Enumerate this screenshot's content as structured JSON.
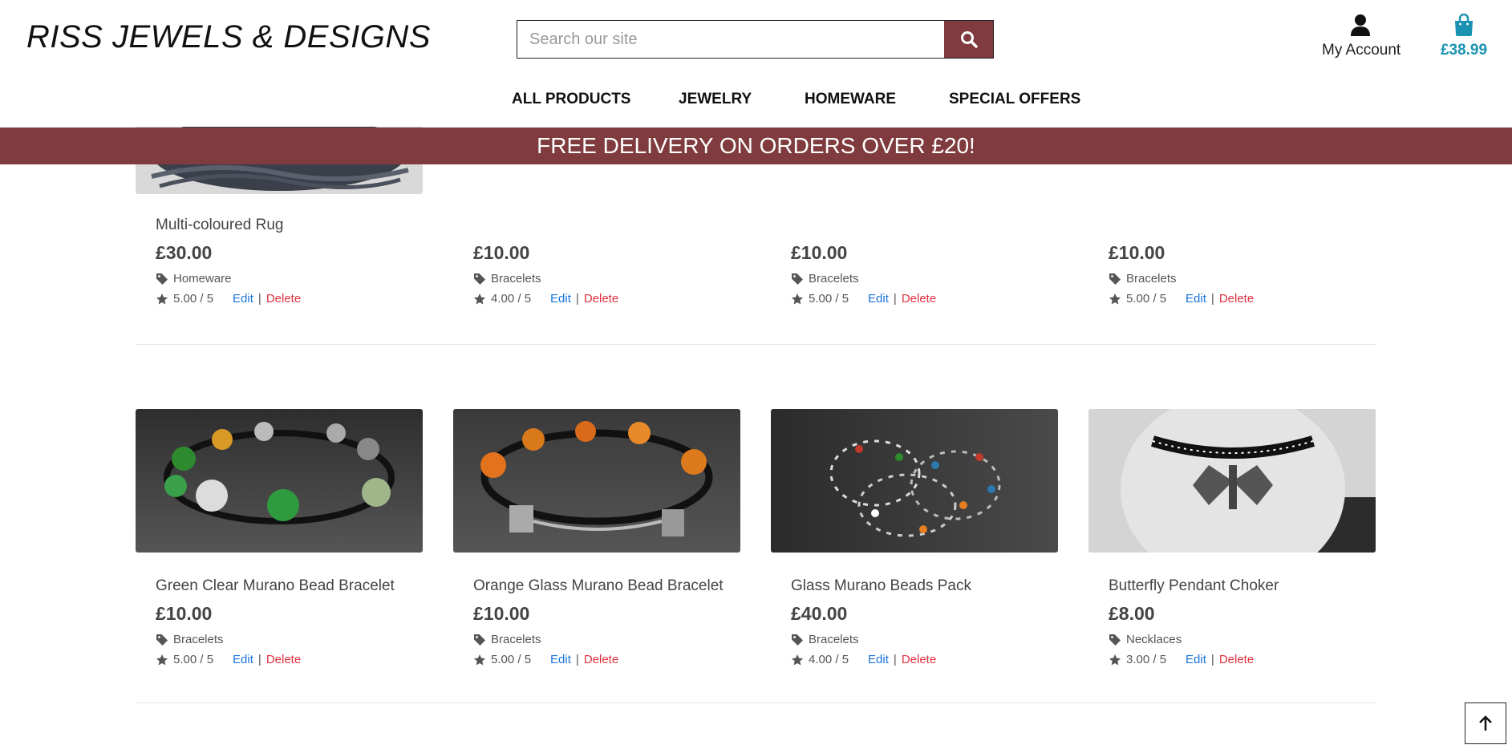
{
  "header": {
    "brand": "RISS JEWELS & DESIGNS",
    "search_placeholder": "Search our site",
    "account_label": "My Account",
    "bag_total": "£38.99"
  },
  "nav": [
    "ALL PRODUCTS",
    "JEWELRY",
    "HOMEWARE",
    "SPECIAL OFFERS"
  ],
  "banner": "FREE DELIVERY ON ORDERS OVER £20!",
  "row1": [
    {
      "name": "Multi-coloured Rug",
      "price": "£30.00",
      "category": "Homeware",
      "rating": "5.00 / 5",
      "edit": "Edit",
      "sep": "|",
      "delete": "Delete"
    },
    {
      "name": "",
      "price": "£10.00",
      "category": "Bracelets",
      "rating": "4.00 / 5",
      "edit": "Edit",
      "sep": "|",
      "delete": "Delete"
    },
    {
      "name": "",
      "price": "£10.00",
      "category": "Bracelets",
      "rating": "5.00 / 5",
      "edit": "Edit",
      "sep": "|",
      "delete": "Delete"
    },
    {
      "name": "",
      "price": "£10.00",
      "category": "Bracelets",
      "rating": "5.00 / 5",
      "edit": "Edit",
      "sep": "|",
      "delete": "Delete"
    }
  ],
  "row2": [
    {
      "name": "Green Clear Murano Bead Bracelet",
      "price": "£10.00",
      "category": "Bracelets",
      "rating": "5.00 / 5",
      "edit": "Edit",
      "sep": "|",
      "delete": "Delete"
    },
    {
      "name": "Orange Glass Murano Bead Bracelet",
      "price": "£10.00",
      "category": "Bracelets",
      "rating": "5.00 / 5",
      "edit": "Edit",
      "sep": "|",
      "delete": "Delete"
    },
    {
      "name": "Glass Murano Beads Pack",
      "price": "£40.00",
      "category": "Bracelets",
      "rating": "4.00 / 5",
      "edit": "Edit",
      "sep": "|",
      "delete": "Delete"
    },
    {
      "name": "Butterfly Pendant Choker",
      "price": "£8.00",
      "category": "Necklaces",
      "rating": "3.00 / 5",
      "edit": "Edit",
      "sep": "|",
      "delete": "Delete"
    }
  ],
  "colors": {
    "brand_maroon": "#7f3b3d",
    "bag_teal": "#1a93b3",
    "edit_blue": "#1a73d9",
    "delete_red": "#e0303f"
  },
  "icons": {
    "search": "search-icon",
    "account": "user-icon",
    "bag": "shopping-bag-icon",
    "category": "tag-icon",
    "rating": "star-icon",
    "back_to_top": "arrow-up-icon"
  }
}
